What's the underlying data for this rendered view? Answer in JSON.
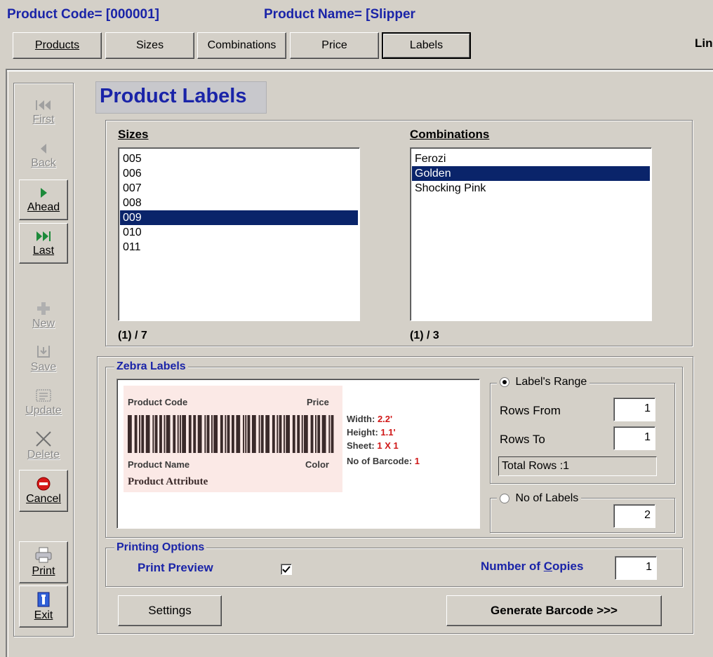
{
  "header": {
    "product_code_label": "Product Code= [000001]",
    "product_name_label": "Product Name= [Slipper",
    "truncated_right": "Lin"
  },
  "tabs": [
    {
      "label": "Products",
      "active": false
    },
    {
      "label": "Sizes",
      "active": false
    },
    {
      "label": "Combinations",
      "active": false
    },
    {
      "label": "Price",
      "active": false
    },
    {
      "label": "Labels",
      "active": true
    }
  ],
  "nav": {
    "first": {
      "label": "First",
      "icon": "skip-first-icon",
      "enabled": false
    },
    "back": {
      "label": "Back",
      "icon": "step-back-icon",
      "enabled": false
    },
    "ahead": {
      "label": "Ahead",
      "icon": "step-ahead-icon",
      "enabled": true
    },
    "last": {
      "label": "Last",
      "icon": "skip-last-icon",
      "enabled": true
    },
    "new": {
      "label": "New",
      "icon": "new-record-icon",
      "enabled": false
    },
    "save": {
      "label": "Save",
      "icon": "save-icon",
      "enabled": false
    },
    "update": {
      "label": "Update",
      "icon": "update-icon",
      "enabled": false
    },
    "delete": {
      "label": "Delete",
      "icon": "delete-x-icon",
      "enabled": false
    },
    "cancel": {
      "label": "Cancel",
      "icon": "cancel-stop-icon",
      "enabled": true
    },
    "print": {
      "label": "Print",
      "icon": "printer-icon",
      "enabled": true
    },
    "exit": {
      "label": "Exit",
      "icon": "exit-door-icon",
      "enabled": true
    }
  },
  "page_title": "Product Labels",
  "sizes": {
    "title": "Sizes",
    "items": [
      "005",
      "006",
      "007",
      "008",
      "009",
      "010",
      "011"
    ],
    "selected_index": 4,
    "counter": "(1) / 7"
  },
  "combinations": {
    "title": "Combinations",
    "items": [
      "Ferozi",
      "Golden",
      "Shocking Pink"
    ],
    "selected_index": 1,
    "counter": "(1) / 3"
  },
  "zebra": {
    "title": "Zebra Labels",
    "preview": {
      "product_code": "Product Code",
      "price": "Price",
      "product_name": "Product Name",
      "color": "Color",
      "product_attribute": "Product Attribute"
    },
    "specs": {
      "width_label": "Width:",
      "width_value": "2.2'",
      "height_label": "Height:",
      "height_value": "1.1'",
      "sheet_label": "Sheet:",
      "sheet_value": "1 X 1",
      "barcodes_label": "No of Barcode:",
      "barcodes_value": "1"
    },
    "range": {
      "label": "Label's Range",
      "selected": true,
      "rows_from_label": "Rows  From",
      "rows_from_value": "1",
      "rows_to_label": "Rows To",
      "rows_to_value": "1",
      "total_rows": "Total Rows :1"
    },
    "no_of_labels": {
      "label": "No of Labels",
      "selected": false,
      "value": "2"
    }
  },
  "printing": {
    "title": "Printing Options",
    "preview_label": "Print Preview",
    "preview_checked": true,
    "copies_label": "Number of Copies",
    "copies_value": "1"
  },
  "buttons": {
    "settings": "Settings",
    "generate": "Generate Barcode >>>"
  },
  "colors": {
    "title_blue": "#1a24a8",
    "selection": "#0a246a",
    "spec_red": "#d01818",
    "preview_bg": "#fbe9e6"
  }
}
